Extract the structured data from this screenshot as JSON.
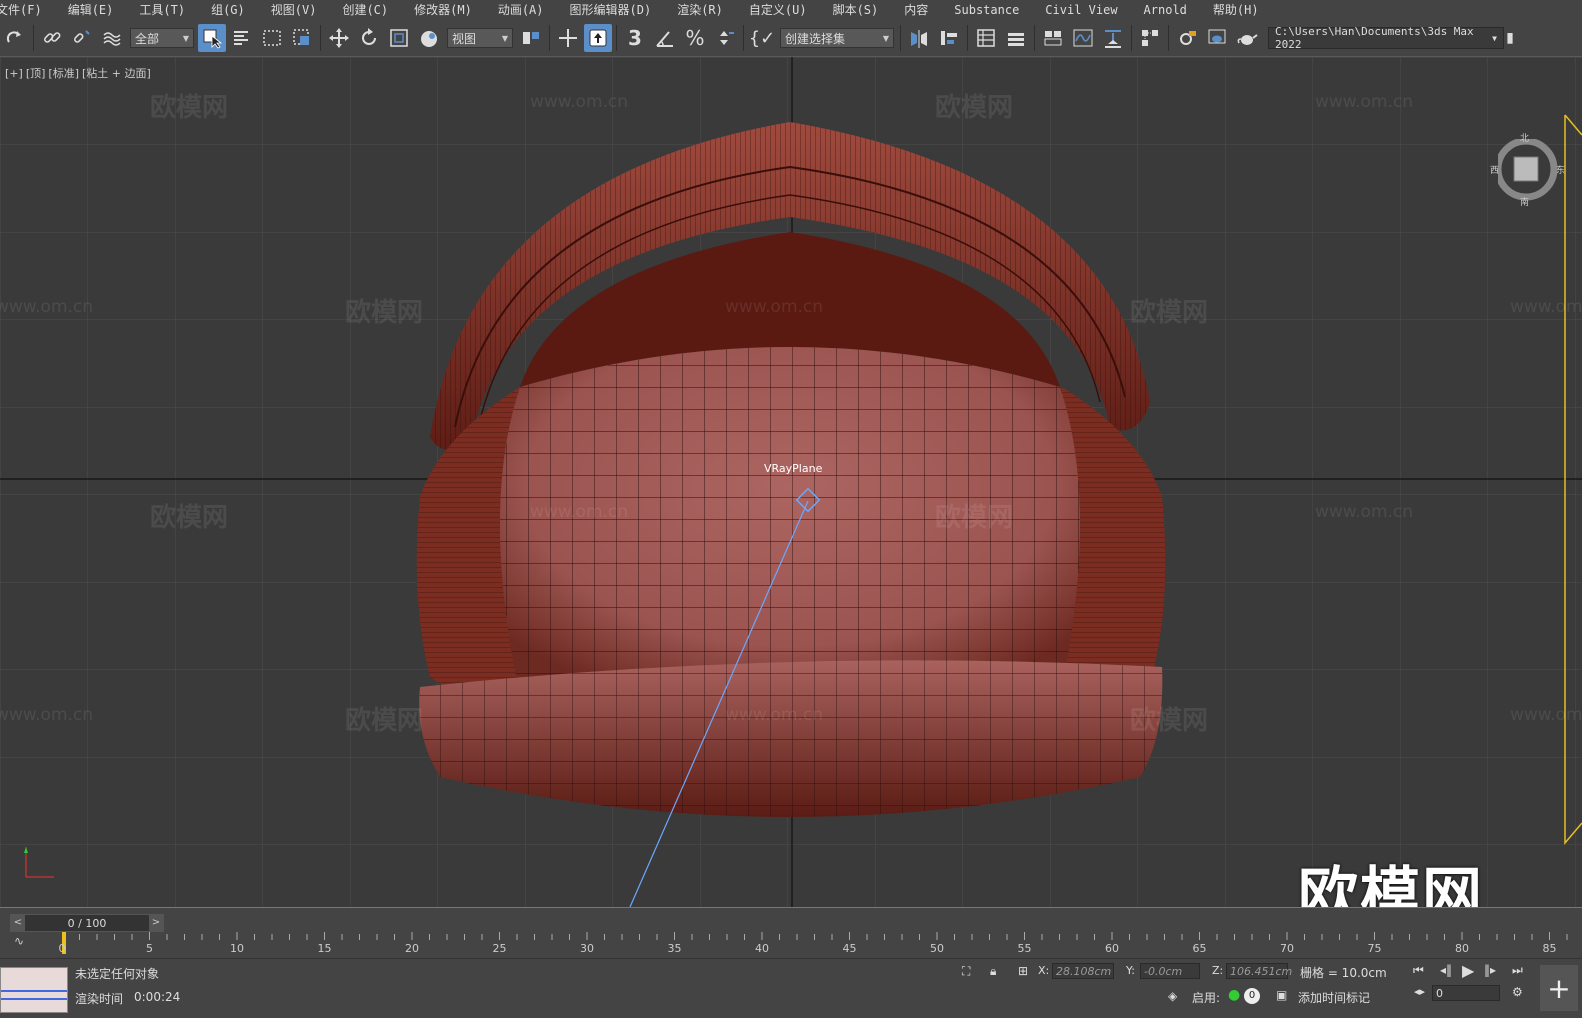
{
  "menubar": [
    "文件(F)",
    "编辑(E)",
    "工具(T)",
    "组(G)",
    "视图(V)",
    "创建(C)",
    "修改器(M)",
    "动画(A)",
    "图形编辑器(D)",
    "渲染(R)",
    "自定义(U)",
    "脚本(S)",
    "内容",
    "Substance",
    "Civil View",
    "Arnold",
    "帮助(H)"
  ],
  "toolbar": {
    "filter_value": "全部",
    "refcoord_value": "视图",
    "selection_set_value": "创建选择集",
    "snap_angle_label": "3",
    "path": "C:\\Users\\Han\\Documents\\3ds Max 2022"
  },
  "viewport": {
    "labels": [
      "[+]",
      "[顶]",
      "[标准]",
      "[粘土 + 边面]"
    ],
    "object_label": "VRayPlane",
    "viewcube": {
      "n": "北",
      "w": "西",
      "e": "东",
      "s": "南"
    },
    "watermark_text": "欧模网",
    "watermark_url": "www.om.cn",
    "big_logo": "欧模网"
  },
  "timeline": {
    "frame_display": "0 / 100",
    "ticks": [
      "0",
      "5",
      "10",
      "15",
      "20",
      "25",
      "30",
      "35",
      "40",
      "45",
      "50",
      "55",
      "60",
      "65",
      "70",
      "75",
      "80",
      "85"
    ]
  },
  "status": {
    "selection": "未选定任何对象",
    "render_time_label": "渲染时间",
    "render_time_value": "0:00:24",
    "x_label": "X:",
    "x_value": "28.108cm",
    "y_label": "Y:",
    "y_value": "-0.0cm",
    "z_label": "Z:",
    "z_value": "106.451cm",
    "grid_label": "栅格 = 10.0cm",
    "enable_label": "启用:",
    "enable_count": "0",
    "add_time_tag": "添加时间标记",
    "frame_value": "0"
  },
  "colors": {
    "accent": "#5b8fc9",
    "chair_dark": "#5e1d15",
    "chair_light": "#b36b68",
    "wire": "#1a0806"
  }
}
